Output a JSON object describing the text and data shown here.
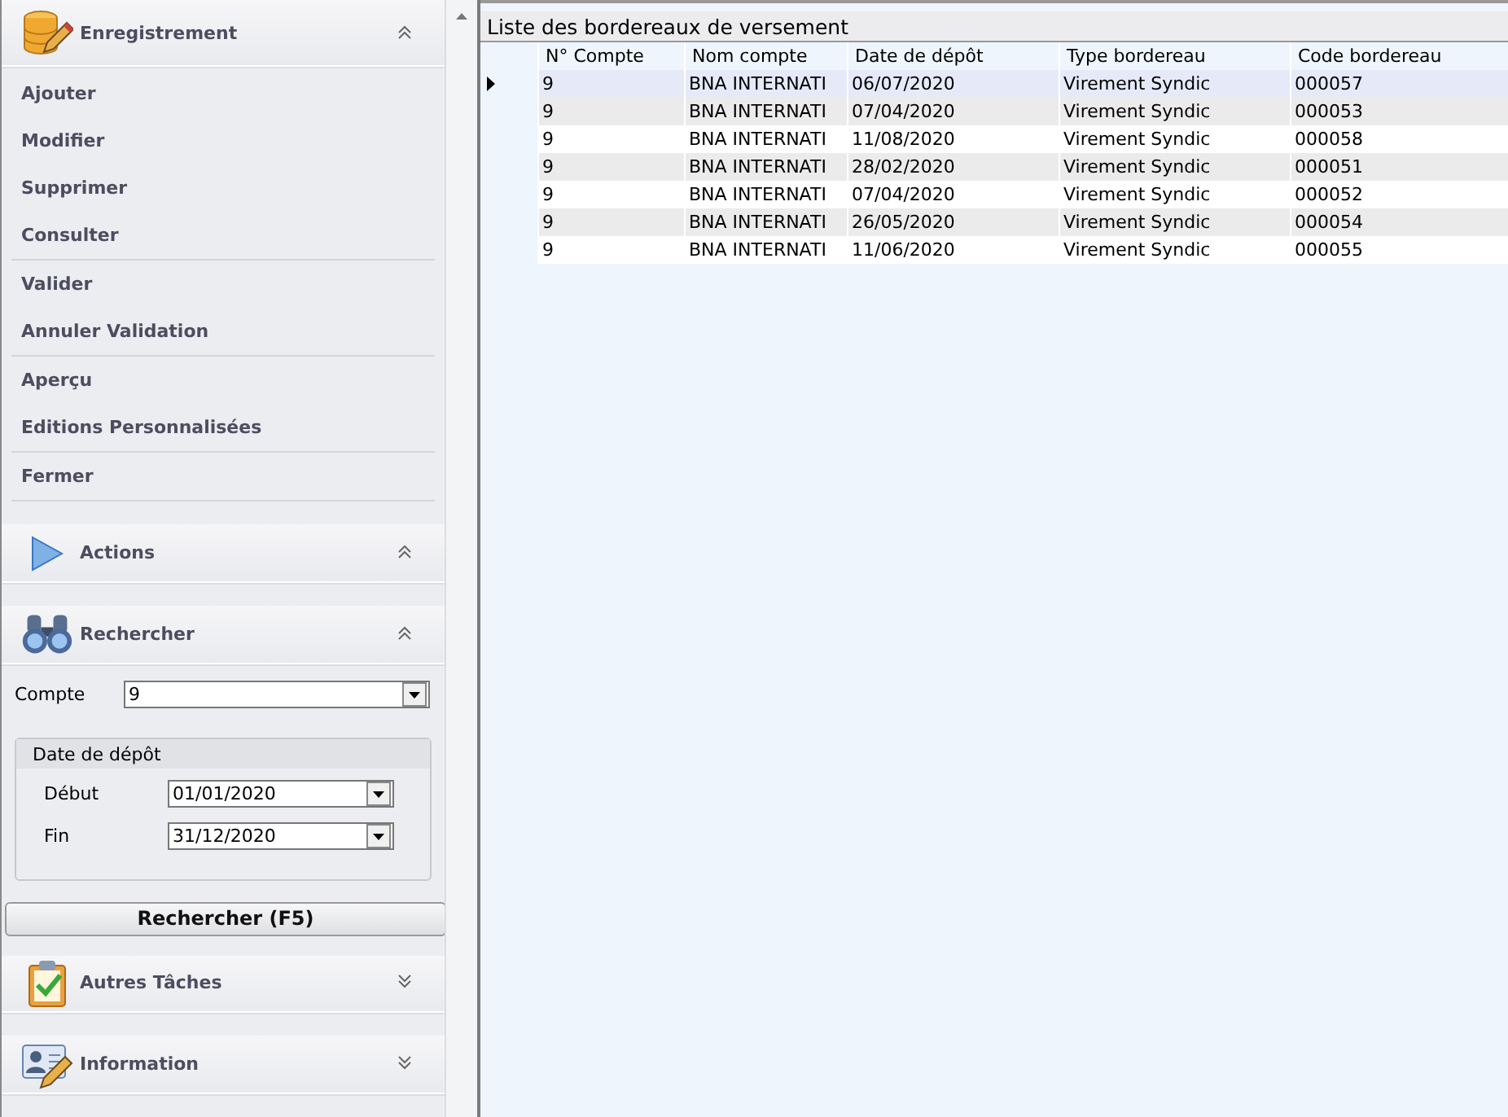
{
  "sidebar": {
    "sections": [
      {
        "kind": "commands",
        "title": "Enregistrement",
        "expanded": true,
        "groups": [
          [
            "Ajouter",
            "Modifier",
            "Supprimer",
            "Consulter"
          ],
          [
            "Valider",
            "Annuler Validation"
          ],
          [
            "Aperçu",
            "Editions Personnalisées"
          ],
          [
            "Fermer"
          ]
        ]
      },
      {
        "kind": "empty",
        "title": "Actions",
        "expanded": true
      },
      {
        "kind": "search",
        "title": "Rechercher",
        "expanded": true,
        "compte": {
          "label": "Compte",
          "value": "9"
        },
        "date_group": {
          "title": "Date de dépôt",
          "fields": [
            {
              "label": "Début",
              "value": "01/01/2020"
            },
            {
              "label": "Fin",
              "value": "31/12/2020"
            }
          ]
        },
        "button": "Rechercher (F5)"
      },
      {
        "kind": "empty",
        "title": "Autres Tâches",
        "expanded": false
      },
      {
        "kind": "empty",
        "title": "Information",
        "expanded": false
      }
    ]
  },
  "table": {
    "title": "Liste des bordereaux de versement",
    "columns": [
      "N° Compte",
      "Nom compte",
      "Date de dépôt",
      "Type bordereau",
      "Code bordereau"
    ],
    "rows": [
      {
        "selected": true,
        "cells": [
          "9",
          "BNA INTERNATI",
          "06/07/2020",
          "Virement Syndic",
          "000057"
        ]
      },
      {
        "selected": false,
        "cells": [
          "9",
          "BNA INTERNATI",
          "07/04/2020",
          "Virement Syndic",
          "000053"
        ]
      },
      {
        "selected": false,
        "cells": [
          "9",
          "BNA INTERNATI",
          "11/08/2020",
          "Virement Syndic",
          "000058"
        ]
      },
      {
        "selected": false,
        "cells": [
          "9",
          "BNA INTERNATI",
          "28/02/2020",
          "Virement Syndic",
          "000051"
        ]
      },
      {
        "selected": false,
        "cells": [
          "9",
          "BNA INTERNATI",
          "07/04/2020",
          "Virement Syndic",
          "000052"
        ]
      },
      {
        "selected": false,
        "cells": [
          "9",
          "BNA INTERNATI",
          "26/05/2020",
          "Virement Syndic",
          "000054"
        ]
      },
      {
        "selected": false,
        "cells": [
          "9",
          "BNA INTERNATI",
          "11/06/2020",
          "Virement Syndic",
          "000055"
        ]
      }
    ]
  }
}
